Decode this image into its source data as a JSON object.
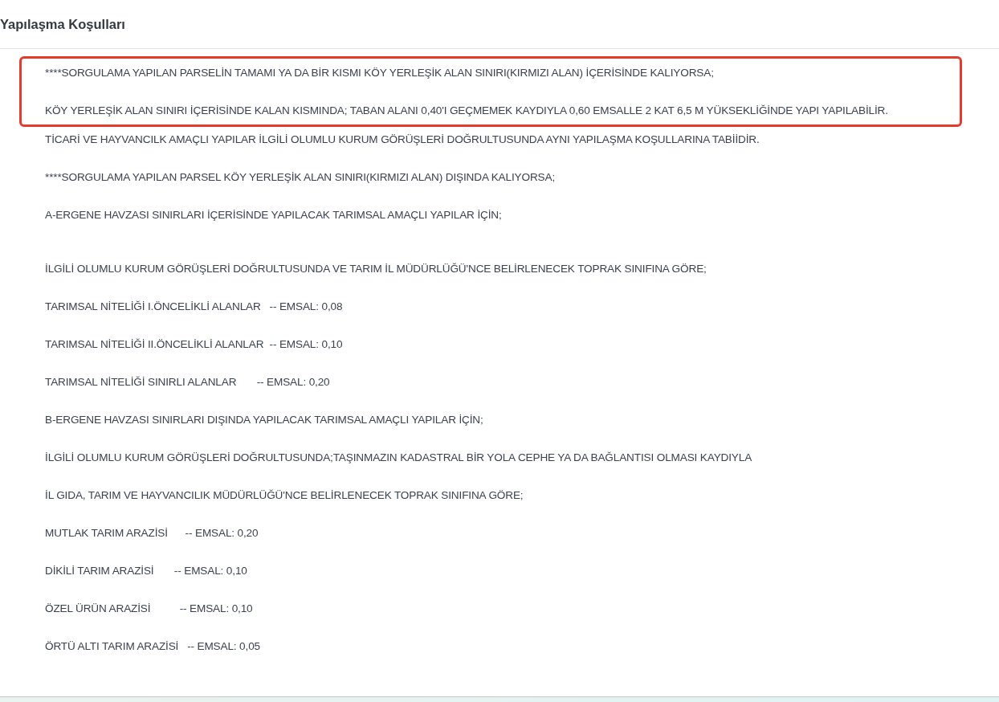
{
  "title": "Yapılaşma Koşulları",
  "highlighted": [
    {
      "text": "****SORGULAMA YAPILAN PARSELİN TAMAMI YA DA BİR KISMI KÖY YERLEŞİK ALAN SINIRI(KIRMIZI ALAN) İÇERİSİNDE KALIYORSA;"
    },
    {
      "text": "KÖY YERLEŞİK ALAN SINIRI İÇERİSİNDE KALAN KISMINDA; TABAN ALANI 0,40'I GEÇMEMEK KAYDIYLA 0,60 EMSALLE 2 KAT 6,5 M YÜKSEKLİĞİNDE YAPI YAPILABİLİR."
    }
  ],
  "paragraphs": [
    {
      "kind": "line",
      "text": "TİCARİ VE HAYVANCILK AMAÇLI YAPILAR İLGİLİ OLUMLU KURUM GÖRÜŞLERİ DOĞRULTUSUNDA AYNI YAPILAŞMA KOŞULLARINA TABİİDİR."
    },
    {
      "kind": "line",
      "text": "****SORGULAMA YAPILAN PARSEL KÖY YERLEŞİK ALAN SINIRI(KIRMIZI ALAN) DIŞINDA KALIYORSA;"
    },
    {
      "kind": "line",
      "text": "A-ERGENE HAVZASI SINIRLARI İÇERİSİNDE YAPILACAK TARIMSAL AMAÇLI YAPILAR İÇİN;"
    },
    {
      "kind": "after_break",
      "text": "İLGİLİ OLUMLU KURUM GÖRÜŞLERİ DOĞRULTUSUNDA VE TARIM İL MÜDÜRLÜĞÜ'NCE BELİRLENECEK TOPRAK SINIFINA GÖRE;"
    },
    {
      "kind": "line",
      "text": "TARIMSAL NİTELİĞİ I.ÖNCELİKLİ ALANLAR   -- EMSAL: 0,08"
    },
    {
      "kind": "line",
      "text": "TARIMSAL NİTELİĞİ II.ÖNCELİKLİ ALANLAR  -- EMSAL: 0,10"
    },
    {
      "kind": "line",
      "text": "TARIMSAL NİTELİĞİ SINIRLI ALANLAR       -- EMSAL: 0,20"
    },
    {
      "kind": "line",
      "text": "B-ERGENE HAVZASI SINIRLARI DIŞINDA YAPILACAK TARIMSAL AMAÇLI YAPILAR İÇİN;"
    },
    {
      "kind": "line",
      "text": "İLGİLİ OLUMLU KURUM GÖRÜŞLERİ DOĞRULTUSUNDA;TAŞINMAZIN KADASTRAL BİR YOLA CEPHE YA DA BAĞLANTISI OLMASI KAYDIYLA"
    },
    {
      "kind": "line",
      "text": "İL GIDA, TARIM VE HAYVANCILIK MÜDÜRLÜĞÜ'NCE BELİRLENECEK TOPRAK SINIFINA GÖRE;"
    },
    {
      "kind": "line",
      "text": "MUTLAK TARIM ARAZİSİ      -- EMSAL: 0,20"
    },
    {
      "kind": "line",
      "text": "DİKİLİ TARIM ARAZİSİ       -- EMSAL: 0,10"
    },
    {
      "kind": "line",
      "text": "ÖZEL ÜRÜN ARAZİSİ          -- EMSAL: 0,10"
    },
    {
      "kind": "line",
      "text": "ÖRTÜ ALTI TARIM ARAZİSİ   -- EMSAL: 0,05"
    }
  ]
}
